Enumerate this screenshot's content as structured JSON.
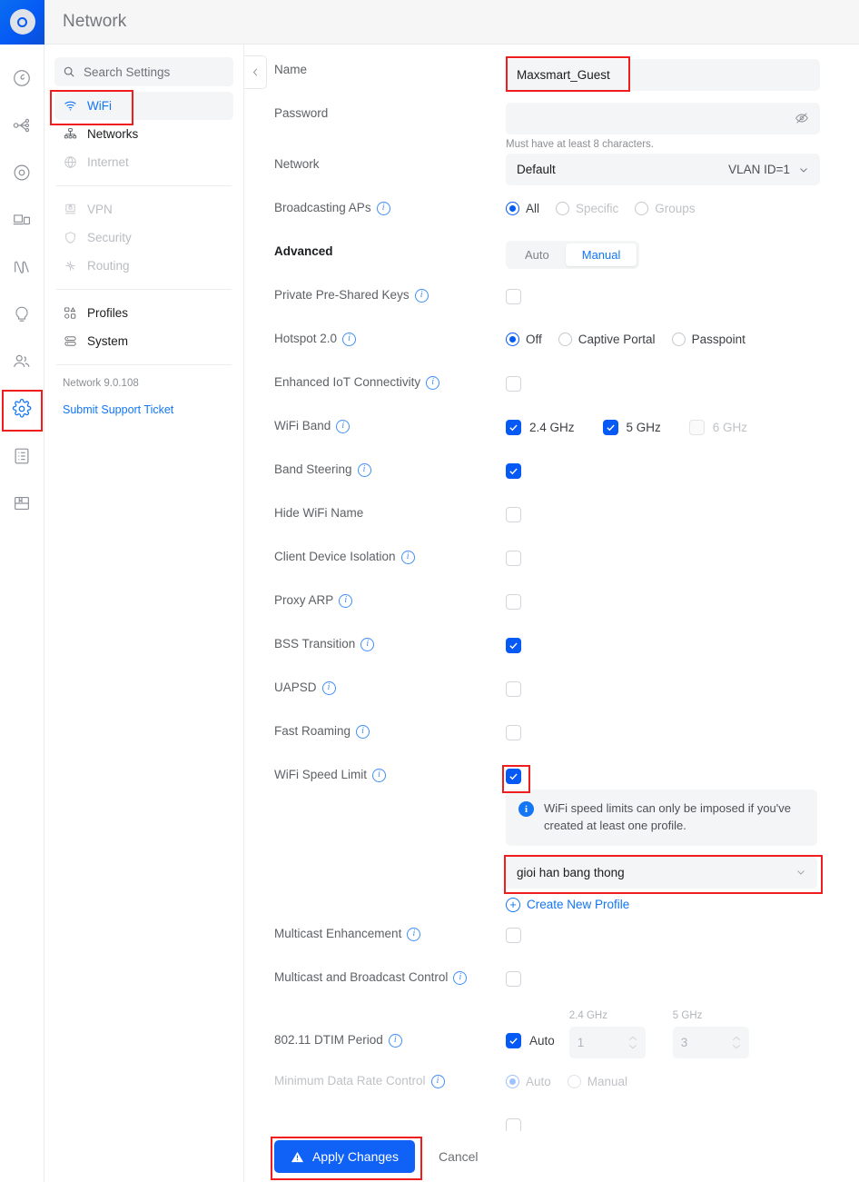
{
  "header": {
    "app_title": "Network",
    "logo_icon": "unifi-circle-logo"
  },
  "rail": {
    "items": [
      {
        "name": "dashboard-icon",
        "active": false
      },
      {
        "name": "topology-icon",
        "active": false
      },
      {
        "name": "unifi-devices-icon",
        "active": false
      },
      {
        "name": "client-devices-icon",
        "active": false
      },
      {
        "name": "insights-icon",
        "active": false
      },
      {
        "name": "hotspot-icon",
        "active": false
      },
      {
        "name": "clients-icon",
        "active": false
      },
      {
        "name": "settings-icon",
        "active": true
      },
      {
        "name": "logs-icon",
        "active": false
      },
      {
        "name": "packages-icon",
        "active": false
      }
    ]
  },
  "sidebar": {
    "search_placeholder": "Search Settings",
    "items": [
      {
        "label": "WiFi",
        "icon": "wifi-icon",
        "state": "active"
      },
      {
        "label": "Networks",
        "icon": "networks-icon",
        "state": "normal"
      },
      {
        "label": "Internet",
        "icon": "globe-icon",
        "state": "disabled"
      }
    ],
    "items2": [
      {
        "label": "VPN",
        "icon": "vpn-icon",
        "state": "disabled"
      },
      {
        "label": "Security",
        "icon": "shield-icon",
        "state": "disabled"
      },
      {
        "label": "Routing",
        "icon": "routing-icon",
        "state": "disabled"
      }
    ],
    "items3": [
      {
        "label": "Profiles",
        "icon": "profiles-icon",
        "state": "normal"
      },
      {
        "label": "System",
        "icon": "system-icon",
        "state": "normal"
      }
    ],
    "version": "Network 9.0.108",
    "support_link": "Submit Support Ticket"
  },
  "form": {
    "back_icon": "chevron-left-icon",
    "name": {
      "label": "Name",
      "value": "Maxsmart_Guest"
    },
    "password": {
      "label": "Password",
      "value": "",
      "hint": "Must have at least 8 characters.",
      "toggle_icon": "eye-off-icon"
    },
    "network": {
      "label": "Network",
      "value": "Default",
      "vlan": "VLAN ID=1",
      "chevron": "chevron-down-icon"
    },
    "broadcasting_aps": {
      "label": "Broadcasting APs",
      "options": [
        {
          "label": "All",
          "selected": true,
          "disabled": false
        },
        {
          "label": "Specific",
          "selected": false,
          "disabled": true
        },
        {
          "label": "Groups",
          "selected": false,
          "disabled": true
        }
      ]
    },
    "advanced": {
      "label": "Advanced",
      "options": [
        "Auto",
        "Manual"
      ],
      "selected": "Manual"
    },
    "private_psk": {
      "label": "Private Pre-Shared Keys",
      "checked": false
    },
    "hotspot": {
      "label": "Hotspot 2.0",
      "options": [
        {
          "label": "Off",
          "selected": true
        },
        {
          "label": "Captive Portal",
          "selected": false
        },
        {
          "label": "Passpoint",
          "selected": false
        }
      ]
    },
    "enhanced_iot": {
      "label": "Enhanced IoT Connectivity",
      "checked": false
    },
    "wifi_band": {
      "label": "WiFi Band",
      "bands": [
        {
          "label": "2.4 GHz",
          "checked": true,
          "disabled": false
        },
        {
          "label": "5 GHz",
          "checked": true,
          "disabled": false
        },
        {
          "label": "6 GHz",
          "checked": false,
          "disabled": true
        }
      ]
    },
    "band_steering": {
      "label": "Band Steering",
      "checked": true
    },
    "hide_wifi_name": {
      "label": "Hide WiFi Name",
      "checked": false
    },
    "client_isolation": {
      "label": "Client Device Isolation",
      "checked": false
    },
    "proxy_arp": {
      "label": "Proxy ARP",
      "checked": false
    },
    "bss_transition": {
      "label": "BSS Transition",
      "checked": true
    },
    "uapsd": {
      "label": "UAPSD",
      "checked": false
    },
    "fast_roaming": {
      "label": "Fast Roaming",
      "checked": false
    },
    "wifi_speed_limit": {
      "label": "WiFi Speed Limit",
      "checked": true
    },
    "speed_limit_banner": "WiFi speed limits can only be imposed if you've created at least one profile.",
    "speed_limit_profile": {
      "value": "gioi han bang thong",
      "chevron": "chevron-down-icon"
    },
    "create_profile": {
      "label": "Create New Profile",
      "icon": "plus-circle-icon"
    },
    "multicast_enhancement": {
      "label": "Multicast Enhancement",
      "checked": false
    },
    "multicast_broadcast": {
      "label": "Multicast and Broadcast Control",
      "checked": false
    },
    "dtim": {
      "label": "802.11 DTIM Period",
      "auto_label": "Auto",
      "auto_checked": true,
      "fields": [
        {
          "caption": "2.4 GHz",
          "value": "1"
        },
        {
          "caption": "5 GHz",
          "value": "3"
        }
      ]
    },
    "min_data_rate": {
      "label": "Minimum Data Rate Control",
      "options": [
        {
          "label": "Auto",
          "selected": true
        },
        {
          "label": "Manual",
          "selected": false
        }
      ]
    }
  },
  "footer": {
    "apply_label": "Apply Changes",
    "apply_icon": "warning-triangle-icon",
    "cancel_label": "Cancel"
  },
  "colors": {
    "accent": "#0559f5",
    "link": "#1276f5",
    "annotation": "#ef1d1d",
    "field_bg": "#f4f5f6"
  }
}
